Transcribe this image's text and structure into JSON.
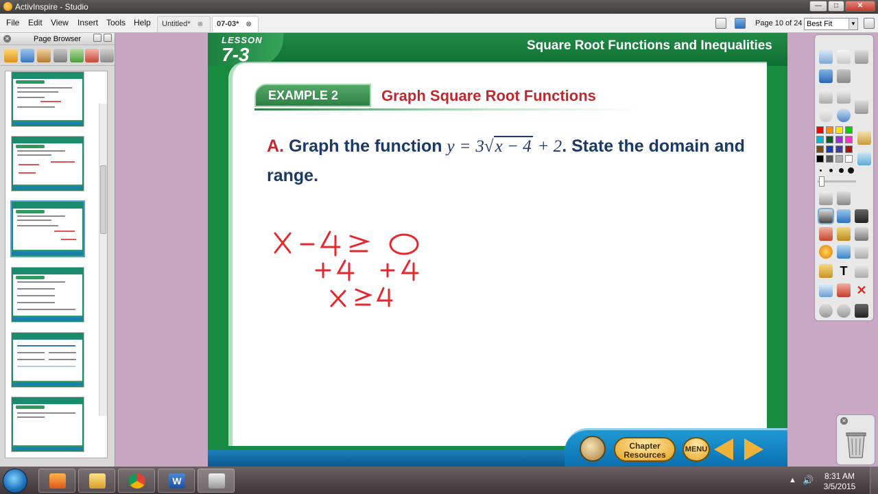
{
  "window": {
    "title": "ActivInspire - Studio"
  },
  "menu": [
    "File",
    "Edit",
    "View",
    "Insert",
    "Tools",
    "Help"
  ],
  "tabs": [
    {
      "label": "Untitled*",
      "close": "⊗",
      "active": false
    },
    {
      "label": "07-03*",
      "close": "⊗",
      "active": true
    }
  ],
  "pager": {
    "text": "Page 10 of 24",
    "zoom": "Best Fit"
  },
  "page_browser": {
    "title": "Page Browser"
  },
  "slide": {
    "lesson_label": "LESSON",
    "lesson_number": "7-3",
    "title": "Square Root Functions and Inequalities",
    "example_label": "EXAMPLE 2",
    "example_title": "Graph Square Root Functions",
    "part": "A.",
    "prompt_pre": "Graph the function",
    "eq_y": "y",
    "eq_eq": "=",
    "eq_coef": "3",
    "eq_rad": "x − 4",
    "eq_tail": "+ 2",
    "prompt_post": ". State the domain and range.",
    "handwriting": [
      "x − 4 ≥ 0",
      "+4  +4",
      "x ≥ 4"
    ],
    "chapter_resources": "Chapter Resources",
    "menu_btn": "MENU"
  },
  "taskbar": {
    "time": "8:31 AM",
    "date": "3/5/2015"
  },
  "colors": {
    "green": "#168a3f",
    "red": "#c0282d",
    "navy": "#1c3a63",
    "blue_nav": "#1f9ad6"
  }
}
